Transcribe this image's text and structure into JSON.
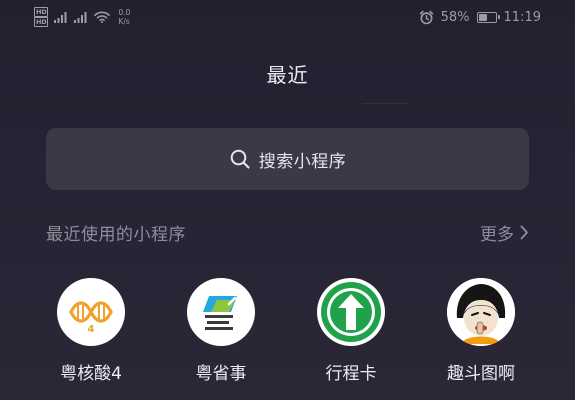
{
  "status_bar": {
    "network_badges": [
      "HD",
      "HD"
    ],
    "net_speed_value": "0.0",
    "net_speed_unit": "K/s",
    "battery_text": "58%",
    "battery_level": 0.58,
    "time": "11:19"
  },
  "header": {
    "title": "最近"
  },
  "search": {
    "label": "搜索小程序"
  },
  "recent_section": {
    "title": "最近使用的小程序",
    "more_label": "更多"
  },
  "apps": [
    {
      "label": "粤核酸4",
      "icon": "dna-4-icon"
    },
    {
      "label": "粤省事",
      "icon": "yueshengshi-icon"
    },
    {
      "label": "行程卡",
      "icon": "up-arrow-circle-icon"
    },
    {
      "label": "趣斗图啊",
      "icon": "meme-face-icon"
    }
  ],
  "colors": {
    "background": "#252232",
    "search_bg": "#3b3847",
    "muted_text": "#8f8d9c",
    "text": "#eeeef2",
    "yuehesuan_orange": "#f0a22c",
    "xingchengka_green": "#1fa24a"
  }
}
